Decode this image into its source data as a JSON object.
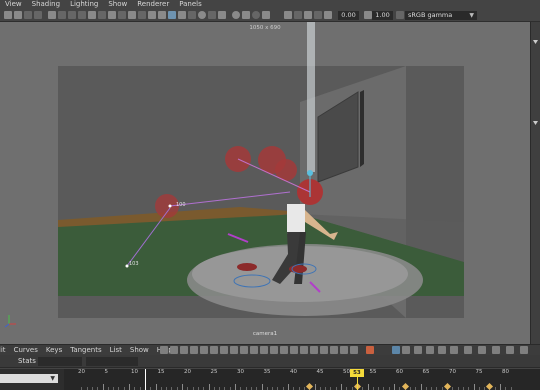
{
  "menu": [
    "View",
    "Shading",
    "Lighting",
    "Show",
    "Renderer",
    "Panels"
  ],
  "toolbar": {
    "exposure_value": "0.00",
    "gamma_value": "1.00",
    "color_space": "sRGB gamma"
  },
  "viewport": {
    "resolution_label": "1050 x 690",
    "camera_label": "camera1",
    "joint_labels": [
      "100",
      "103"
    ]
  },
  "graph_editor": {
    "menu": [
      "Edit",
      "Curves",
      "Keys",
      "Tangents",
      "List",
      "Show",
      "Help"
    ],
    "stats_label": "Stats"
  },
  "timeline": {
    "ticks": [
      "5",
      "10",
      "15",
      "20",
      "25",
      "30",
      "35",
      "40",
      "45",
      "50",
      "55",
      "60",
      "65",
      "70",
      "75",
      "80"
    ],
    "current_frame": "53",
    "left_value": "20"
  },
  "colors": {
    "ui_background": "#444444",
    "viewport_background": "#6f6f6f",
    "playhead": "#f4da3a",
    "key_marker": "#e2b55a",
    "selected_tool": "#c9603f"
  }
}
